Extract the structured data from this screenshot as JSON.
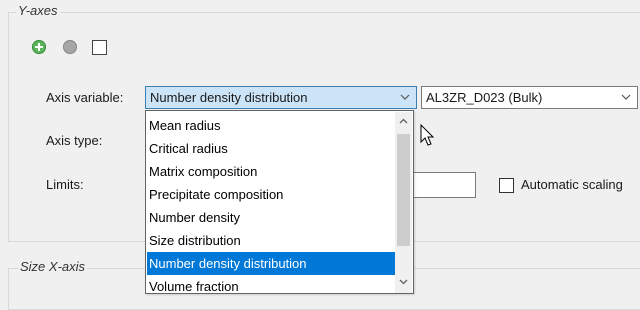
{
  "yaxes": {
    "title": "Y-axes",
    "axis_variable_label": "Axis variable:",
    "axis_variable_value": "Number density distribution",
    "phase_value": "AL3ZR_D023 (Bulk)",
    "axis_type_label": "Axis type:",
    "limits_label": "Limits:",
    "automatic_scaling_label": "Automatic scaling"
  },
  "size_xaxis": {
    "title": "Size X-axis"
  },
  "dropdown": {
    "items": [
      "Mean radius",
      "Critical radius",
      "Matrix composition",
      "Precipitate composition",
      "Number density",
      "Size distribution",
      "Number density distribution",
      "Volume fraction"
    ],
    "selected": "Number density distribution"
  },
  "colors": {
    "accent": "#0078d7",
    "focused_combo": "#cce4f7",
    "add_icon": "#5bb55b",
    "remove_icon": "#a6a6a6"
  },
  "icons": [
    "plus-circle-icon",
    "minus-circle-icon",
    "checkbox-icon",
    "chevron-down-icon",
    "chevron-up-icon",
    "mouse-pointer-icon"
  ]
}
